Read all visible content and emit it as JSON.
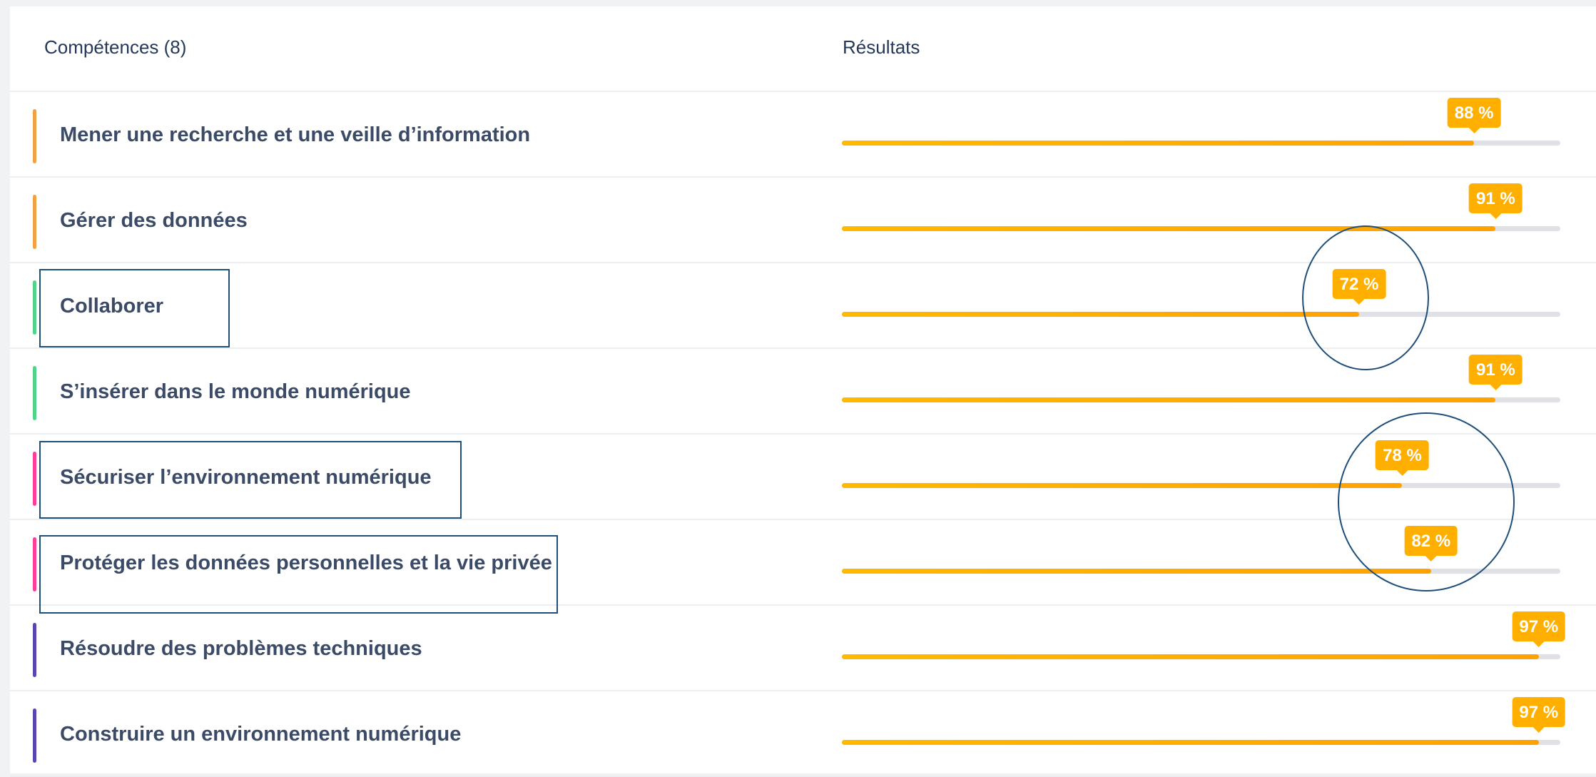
{
  "header": {
    "competences_title": "Compétences (8)",
    "results_title": "Résultats"
  },
  "colors": {
    "progress_fill": "#ffaf00",
    "progress_track": "#dfe1e7",
    "annotation": "#1f4e79"
  },
  "rows": [
    {
      "label": "Mener une recherche et une veille d’information",
      "value": 88,
      "percent_text": "88 %",
      "accent": "#f0a245"
    },
    {
      "label": "Gérer des données",
      "value": 91,
      "percent_text": "91 %",
      "accent": "#f0a245"
    },
    {
      "label": "Collaborer",
      "value": 72,
      "percent_text": "72 %",
      "accent": "#52d38a"
    },
    {
      "label": "S’insérer dans le monde numérique",
      "value": 91,
      "percent_text": "91 %",
      "accent": "#52d38a"
    },
    {
      "label": "Sécuriser l’environnement numérique",
      "value": 78,
      "percent_text": "78 %",
      "accent": "#ff3e9a"
    },
    {
      "label": "Protéger les données personnelles et la vie privée",
      "value": 82,
      "percent_text": "82 %",
      "accent": "#ff3e9a"
    },
    {
      "label": "Résoudre des problèmes techniques",
      "value": 97,
      "percent_text": "97 %",
      "accent": "#5b46b0"
    },
    {
      "label": "Construire un environnement numérique",
      "value": 97,
      "percent_text": "97 %",
      "accent": "#5b46b0"
    }
  ]
}
